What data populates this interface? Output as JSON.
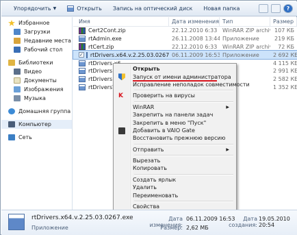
{
  "toolbar": {
    "organize_label": "Упорядочить",
    "open_label": "Открыть",
    "burn_label": "Запись на оптический диск",
    "new_folder_label": "Новая папка",
    "help_label": "?"
  },
  "nav": {
    "favorites": {
      "label": "Избранное",
      "items": [
        {
          "label": "Загрузки"
        },
        {
          "label": "Недавние места"
        },
        {
          "label": "Рабочий стол"
        }
      ]
    },
    "libraries": {
      "label": "Библиотеки",
      "items": [
        {
          "label": "Видео"
        },
        {
          "label": "Документы"
        },
        {
          "label": "Изображения"
        },
        {
          "label": "Музыка"
        }
      ]
    },
    "homegroup": "Домашняя группа",
    "computer": "Компьютер",
    "network": "Сеть"
  },
  "columns": {
    "name": "Имя",
    "date": "Дата изменения",
    "type": "Тип",
    "size": "Размер"
  },
  "files": [
    {
      "name": "Cert2Cont.zip",
      "date": "22.12.2010 6:33",
      "type": "WinRAR ZIP archive",
      "size": "107 КБ",
      "icon": "zip"
    },
    {
      "name": "rtAdmin.exe",
      "date": "26.11.2008 13:44",
      "type": "Приложение",
      "size": "219 КБ",
      "icon": "exe"
    },
    {
      "name": "rtCert.zip",
      "date": "22.12.2010 6:33",
      "type": "WinRAR ZIP archive",
      "size": "72 КБ",
      "icon": "zip"
    },
    {
      "name": "rtDrivers.x64.v.2.25.03.0267.exe",
      "date": "06.11.2009 16:53",
      "type": "Приложение",
      "size": "2 692 КБ",
      "icon": "exe",
      "selected": true
    },
    {
      "name": "rtDrivers.x6",
      "date": "",
      "type": "",
      "size": "4 115 КБ",
      "icon": "exe"
    },
    {
      "name": "rtDrivers.x6",
      "date": "",
      "type": "",
      "size": "2 991 КБ",
      "icon": "exe"
    },
    {
      "name": "rtDrivers.x8",
      "date": "",
      "type": "",
      "size": "2 582 КБ",
      "icon": "exe"
    },
    {
      "name": "rtDriversWin9",
      "date": "",
      "type": "",
      "size": "1 352 КБ",
      "icon": "exe"
    }
  ],
  "menu": {
    "open": "Открыть",
    "run_as_admin": "Запуск от имени администратора",
    "compat": "Исправление неполадок совместимости",
    "scan": "Проверить на вирусы",
    "winrar": "WinRAR",
    "pin_taskbar": "Закрепить на панели задач",
    "pin_start": "Закрепить в меню \"Пуск\"",
    "vaio_gate": "Добавить в VAIO Gate",
    "restore": "Восстановить прежнюю версию",
    "send_to": "Отправить",
    "cut": "Вырезать",
    "copy": "Копировать",
    "shortcut": "Создать ярлык",
    "delete": "Удалить",
    "rename": "Переименовать",
    "properties": "Свойства"
  },
  "details": {
    "name": "rtDrivers.x64.v.2.25.03.0267.exe",
    "type": "Приложение",
    "modified_label": "Дата изменения:",
    "modified_value": "06.11.2009 16:53",
    "size_label": "Размер:",
    "size_value": "2,62 МБ",
    "created_label": "Дата создания:",
    "created_value": "19.05.2010 20:54"
  },
  "colors": {
    "accent": "#1e395b",
    "selection": "#cce3fb",
    "highlight_underline": "#d8141d"
  }
}
